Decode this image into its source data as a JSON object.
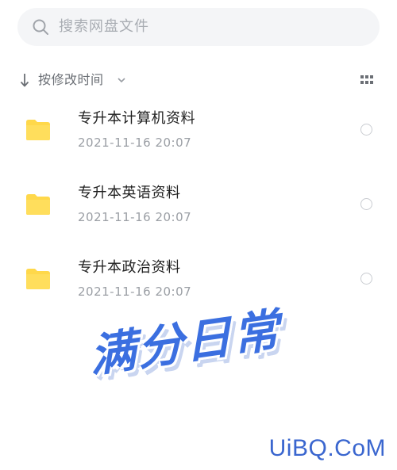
{
  "search": {
    "placeholder": "搜索网盘文件"
  },
  "sort": {
    "label": "按修改时间"
  },
  "files": [
    {
      "name": "专升本计算机资料",
      "modified": "2021-11-16  20:07"
    },
    {
      "name": "专升本英语资料",
      "modified": "2021-11-16  20:07"
    },
    {
      "name": "专升本政治资料",
      "modified": "2021-11-16  20:07"
    }
  ],
  "overlay": {
    "stamp_text": "满分日常",
    "watermark": "UiBQ.CoM"
  },
  "colors": {
    "folder": "#ffd84a",
    "accent": "#3b6fe0",
    "muted_text": "#9a9ea4",
    "search_bg": "#f4f5f7"
  },
  "icons": {
    "search": "search-icon",
    "sort_arrow": "arrow-down-icon",
    "sort_chevron": "chevron-down-icon",
    "view_toggle": "grid-view-icon",
    "folder": "folder-icon",
    "select": "radio-circle-icon"
  }
}
